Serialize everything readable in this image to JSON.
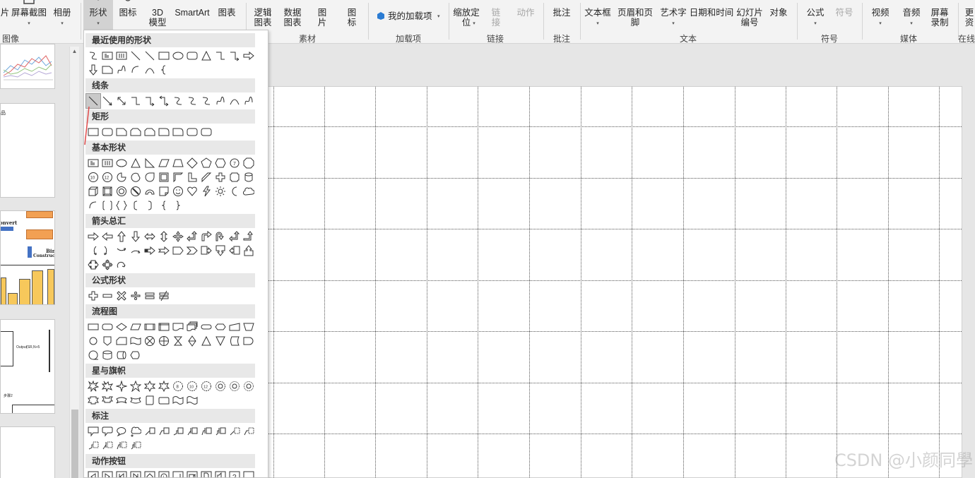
{
  "ribbon": {
    "partial_left_label": "片",
    "buttons": {
      "screenshot": "屏幕截图",
      "album": "相册",
      "shapes": "形状",
      "icons": "图标",
      "model3d": "3D\n模型",
      "smartart": "SmartArt",
      "chart": "图表",
      "logic_chart": "逻辑\n图表",
      "data_chart": "数据\n图表",
      "picture": "图\n片",
      "icon2": "图\n标",
      "my_addins": "我的加载项",
      "zoom": "缩放定\n位",
      "link": "链\n接",
      "action": "动作",
      "comment": "批注",
      "textbox": "文本框",
      "header_footer": "页眉和页脚",
      "wordart": "艺术字",
      "datetime": "日期和时间",
      "slide_number": "幻灯片\n编号",
      "object": "对象",
      "equation": "公式",
      "symbol": "符号",
      "video": "视频",
      "audio": "音频",
      "screen_record": "屏幕\n录制",
      "partial_right": "更\n资"
    },
    "groups": {
      "images": "图像",
      "material": "素材",
      "addins": "加载项",
      "links": "链接",
      "comments": "批注",
      "text": "文本",
      "symbols": "符号",
      "media": "媒体",
      "online": "在线"
    }
  },
  "thumbnails": {
    "slide2_text": "品",
    "slide3_text1": "onvert",
    "slide3_text2": "Bin",
    "slide3_text3": "Construc",
    "slide4_text1": "Output",
    "slide4_text2": "(SR,N+5",
    "slide4_text3": "步骤2"
  },
  "shapes_menu": {
    "categories": {
      "recent": "最近使用的形状",
      "lines": "线条",
      "rectangles": "矩形",
      "basic": "基本形状",
      "arrows": "箭头总汇",
      "equation": "公式形状",
      "flowchart": "流程图",
      "stars": "星与旗帜",
      "callouts": "标注",
      "action_buttons": "动作按钮"
    },
    "selected_shape": "line"
  },
  "colors": {
    "accent_red": "#e04b4b",
    "brand_blue": "#2b7cd3"
  },
  "watermark": "CSDN @小颜同學"
}
